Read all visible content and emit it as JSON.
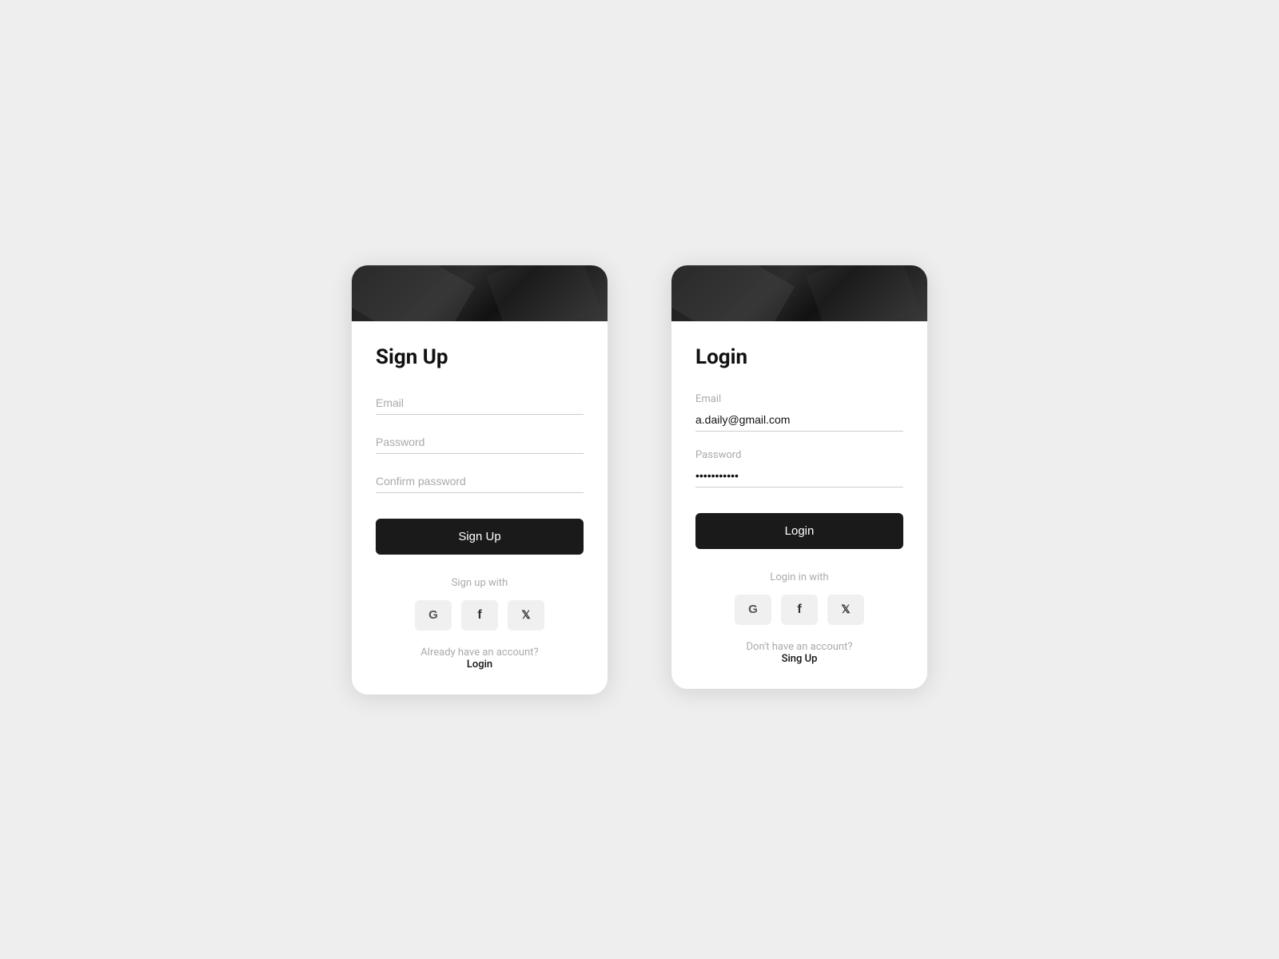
{
  "signup": {
    "title": "Sign Up",
    "email_placeholder": "Email",
    "password_placeholder": "Password",
    "confirm_password_placeholder": "Confirm password",
    "button_label": "Sign Up",
    "social_label": "Sign up with",
    "footer_question": "Already have an account?",
    "footer_link": "Login",
    "social_buttons": [
      {
        "id": "google",
        "label": "G"
      },
      {
        "id": "facebook",
        "label": "f"
      },
      {
        "id": "twitter",
        "label": "🐦"
      }
    ]
  },
  "login": {
    "title": "Login",
    "email_label": "Email",
    "email_value": "a.daily@gmail.com",
    "password_label": "Password",
    "password_value": "••••••••••",
    "button_label": "Login",
    "social_label": "Login in with",
    "footer_question": "Don't have an account?",
    "footer_link": "Sing Up",
    "social_buttons": [
      {
        "id": "google",
        "label": "G"
      },
      {
        "id": "facebook",
        "label": "f"
      },
      {
        "id": "twitter",
        "label": "🐦"
      }
    ]
  }
}
